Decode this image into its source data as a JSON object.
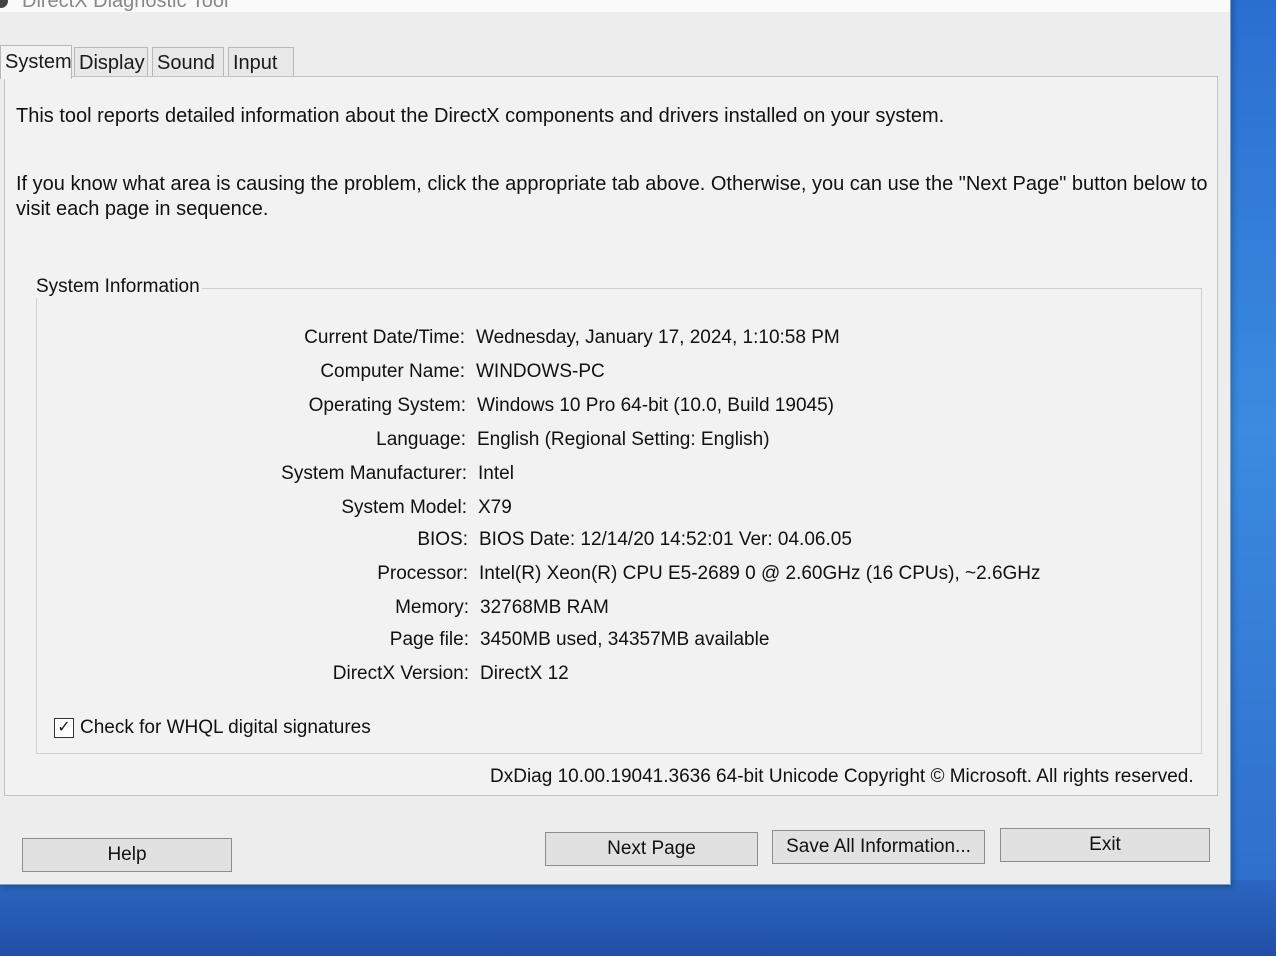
{
  "window": {
    "title": "DirectX Diagnostic Tool"
  },
  "tabs": [
    {
      "label": "System",
      "active": true
    },
    {
      "label": "Display",
      "active": false
    },
    {
      "label": "Sound",
      "active": false
    },
    {
      "label": "Input",
      "active": false
    }
  ],
  "intro": {
    "line1": "This tool reports detailed information about the DirectX components and drivers installed on your system.",
    "line2a": "If you know what area is causing the problem, click the appropriate tab above.  Otherwise, you can use the \"Next Page\" button below to",
    "line2b": "visit each page in sequence."
  },
  "system_info": {
    "heading": "System Information",
    "rows": [
      {
        "label": "Current Date/Time:",
        "value": "Wednesday, January 17, 2024, 1:10:58 PM"
      },
      {
        "label": "Computer Name:",
        "value": "WINDOWS-PC"
      },
      {
        "label": "Operating System:",
        "value": "Windows 10 Pro 64-bit (10.0, Build 19045)"
      },
      {
        "label": "Language:",
        "value": "English (Regional Setting: English)"
      },
      {
        "label": "System Manufacturer:",
        "value": "Intel"
      },
      {
        "label": "System Model:",
        "value": "X79"
      },
      {
        "label": "BIOS:",
        "value": "BIOS Date: 12/14/20 14:52:01 Ver: 04.06.05"
      },
      {
        "label": "Processor:",
        "value": "Intel(R) Xeon(R) CPU E5-2689 0 @ 2.60GHz (16 CPUs), ~2.6GHz"
      },
      {
        "label": "Memory:",
        "value": "32768MB RAM"
      },
      {
        "label": "Page file:",
        "value": "3450MB used, 34357MB available"
      },
      {
        "label": "DirectX Version:",
        "value": "DirectX 12"
      }
    ]
  },
  "whql": {
    "label": "Check for WHQL digital signatures",
    "checked": true,
    "check_mark": "✓"
  },
  "footer": {
    "copyright": "DxDiag 10.00.19041.3636 64-bit Unicode  Copyright © Microsoft. All rights reserved."
  },
  "buttons": {
    "help": "Help",
    "next_page": "Next Page",
    "save_all": "Save All Information...",
    "exit": "Exit"
  }
}
